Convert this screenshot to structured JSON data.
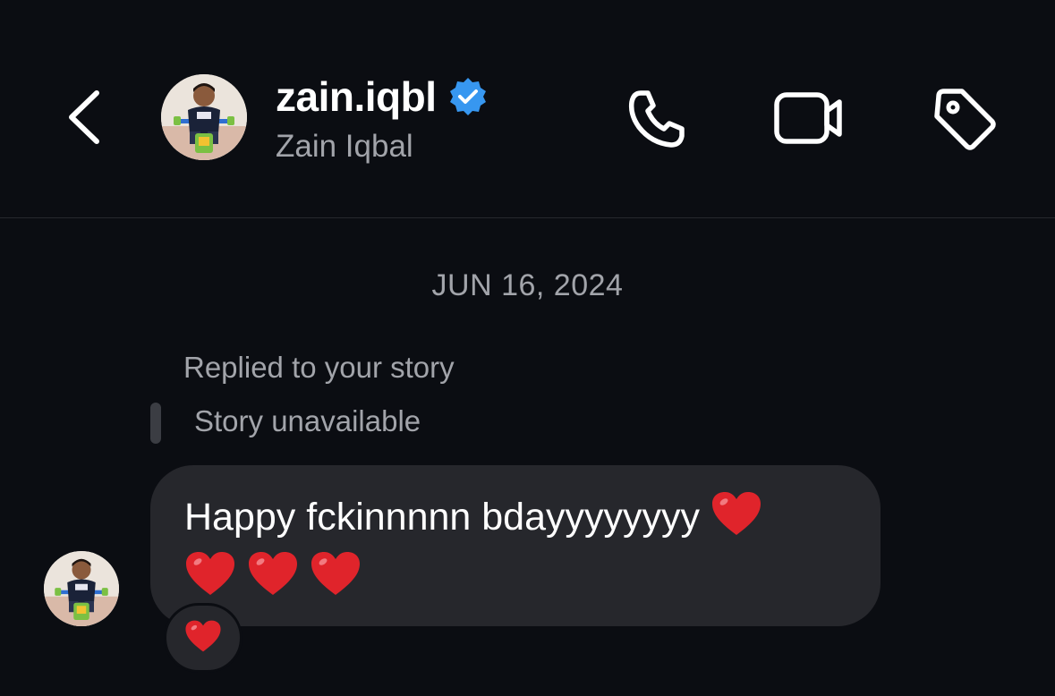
{
  "header": {
    "username": "zain.iqbl",
    "full_name": "Zain Iqbal",
    "verified": true,
    "icons": {
      "back": "chevron-left-icon",
      "call": "phone-icon",
      "video": "video-camera-icon",
      "tag": "tag-icon"
    }
  },
  "conversation": {
    "date_separator": "JUN 16, 2024",
    "reply_label": "Replied to your story",
    "story_status": "Story unavailable",
    "message": {
      "text": "Happy fckinnnnn bdayyyyyyyy",
      "hearts": "❤️❤️❤️❤️",
      "reaction": "❤️"
    }
  },
  "colors": {
    "background": "#0b0d12",
    "bubble": "#26272c",
    "secondary_text": "#a2a4aa",
    "verified_blue": "#3797f0",
    "heart_red": "#e0242b"
  }
}
